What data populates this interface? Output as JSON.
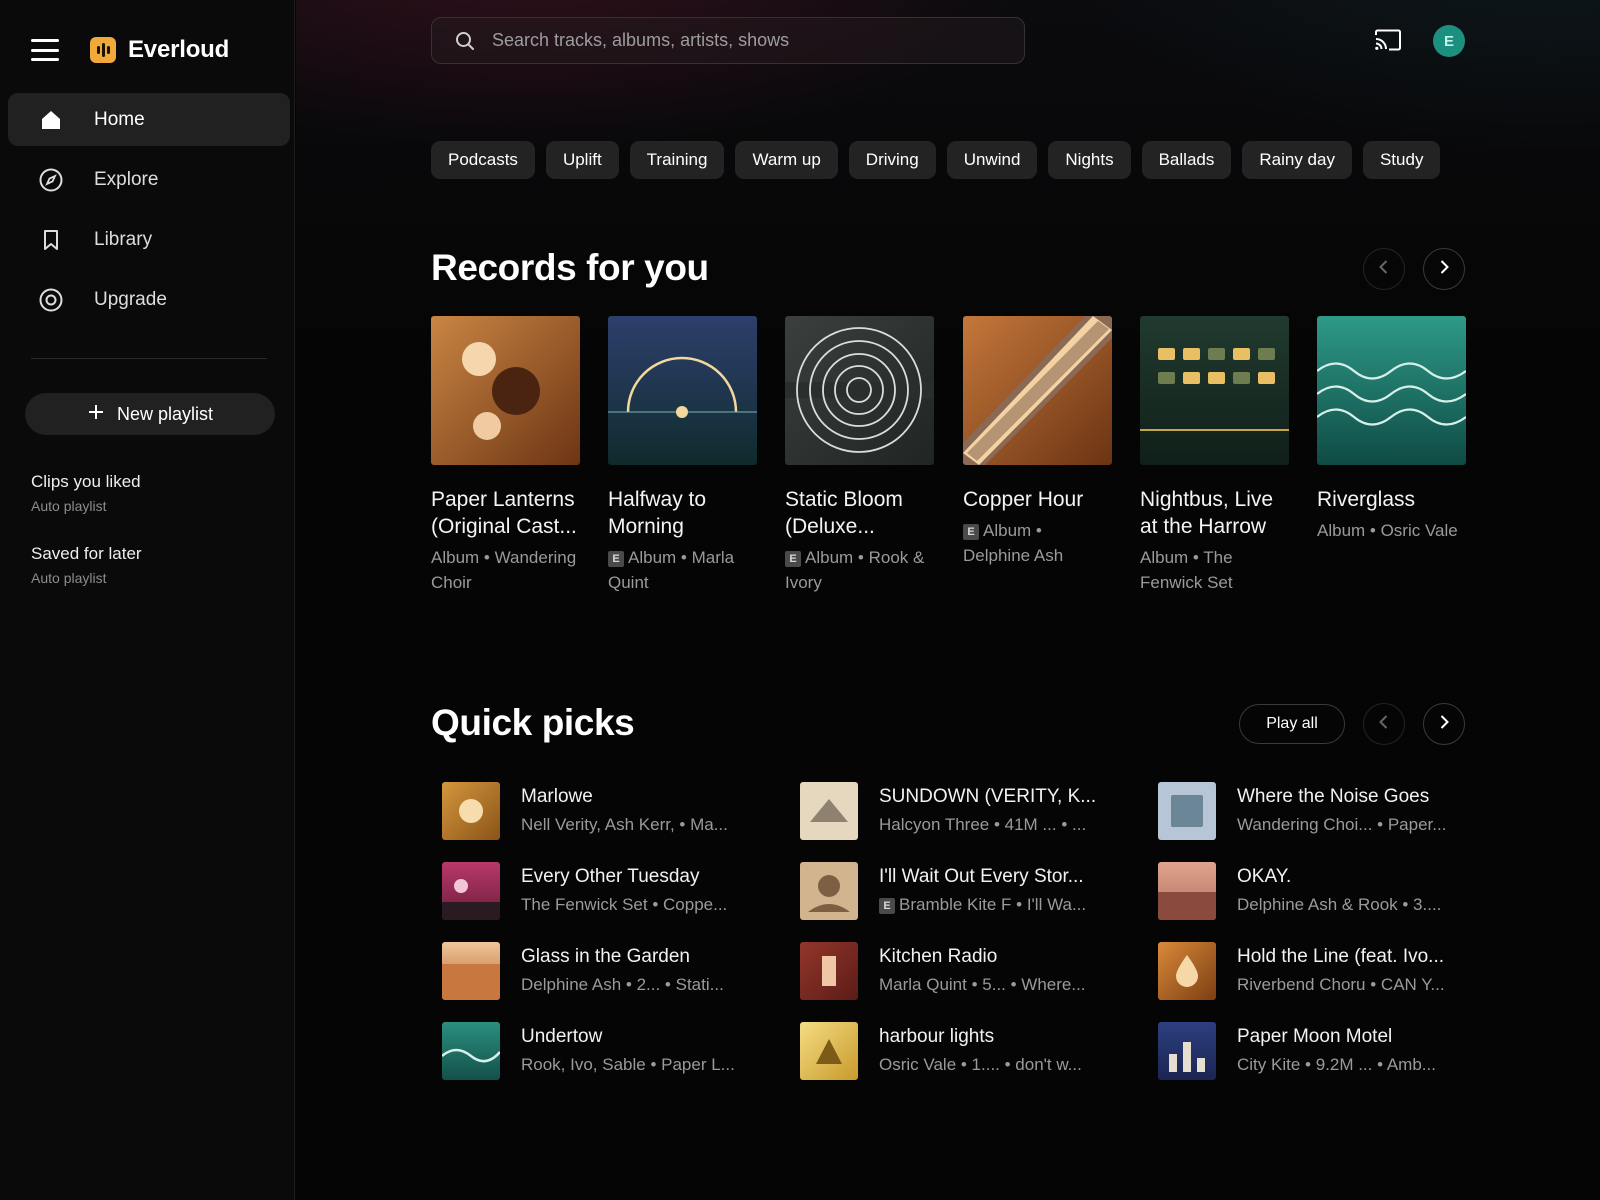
{
  "app": {
    "name": "Everloud",
    "accent": "#f0a93b",
    "avatar_color": "#1c8f7f"
  },
  "sidebar": {
    "nav": [
      {
        "label": "Home",
        "icon": "home-icon",
        "active": true
      },
      {
        "label": "Explore",
        "icon": "compass-icon",
        "active": false
      },
      {
        "label": "Library",
        "icon": "bookmark-icon",
        "active": false
      },
      {
        "label": "Upgrade",
        "icon": "upgrade-icon",
        "active": false
      }
    ],
    "new_playlist": "New playlist",
    "playlists": [
      {
        "title": "Clips you liked",
        "subtitle": "Auto playlist"
      },
      {
        "title": "Saved for later",
        "subtitle": "Auto playlist"
      }
    ]
  },
  "header": {
    "search_placeholder": "Search tracks, albums, artists, shows",
    "avatar_initial": "E"
  },
  "chips": [
    "Podcasts",
    "Uplift",
    "Training",
    "Warm up",
    "Driving",
    "Unwind",
    "Nights",
    "Ballads",
    "Rainy day",
    "Study"
  ],
  "records": {
    "title": "Records for you",
    "items": [
      {
        "title": "Paper Lanterns (Original Cast...",
        "explicit": false,
        "subtitle": "Album • Wandering Choir"
      },
      {
        "title": "Halfway to Morning",
        "explicit": true,
        "subtitle": "Album • Marla Quint"
      },
      {
        "title": "Static Bloom (Deluxe...",
        "explicit": true,
        "subtitle": "Album • Rook & Ivory"
      },
      {
        "title": "Copper Hour",
        "explicit": true,
        "subtitle": "Album • Delphine Ash"
      },
      {
        "title": "Nightbus, Live at the Harrow",
        "explicit": false,
        "subtitle": "Album • The Fenwick Set"
      },
      {
        "title": "Riverglass",
        "explicit": false,
        "subtitle": "Album • Osric Vale"
      }
    ]
  },
  "quick_picks": {
    "title": "Quick picks",
    "play_all": "Play all",
    "items": [
      {
        "title": "Marlowe",
        "subtitle": "Nell Verity, Ash Kerr, • Ma...",
        "explicit": false
      },
      {
        "title": "Every Other Tuesday",
        "subtitle": "The Fenwick Set • Coppe...",
        "explicit": false
      },
      {
        "title": "Glass in the Garden",
        "subtitle": "Delphine Ash • 2... • Stati...",
        "explicit": false
      },
      {
        "title": "Undertow",
        "subtitle": "Rook, Ivo, Sable • Paper L...",
        "explicit": false
      },
      {
        "title": "SUNDOWN (VERITY, K...",
        "subtitle": "Halcyon Three • 41M ... • ...",
        "explicit": false
      },
      {
        "title": "I'll Wait Out Every Stor...",
        "subtitle": "Bramble Kite F • I'll Wa...",
        "explicit": true
      },
      {
        "title": "Kitchen Radio",
        "subtitle": "Marla Quint • 5... • Where...",
        "explicit": false
      },
      {
        "title": "harbour lights",
        "subtitle": "Osric Vale • 1.... • don't w...",
        "explicit": false
      },
      {
        "title": "Where the Noise Goes",
        "subtitle": "Wandering Choi... • Paper...",
        "explicit": false
      },
      {
        "title": "OKAY.",
        "subtitle": "Delphine Ash & Rook • 3....",
        "explicit": false
      },
      {
        "title": "Hold the Line (feat. Ivo...",
        "subtitle": "Riverbend Choru • CAN Y...",
        "explicit": false
      },
      {
        "title": "Paper Moon Motel",
        "subtitle": "City Kite • 9.2M ... • Amb...",
        "explicit": false
      }
    ]
  }
}
